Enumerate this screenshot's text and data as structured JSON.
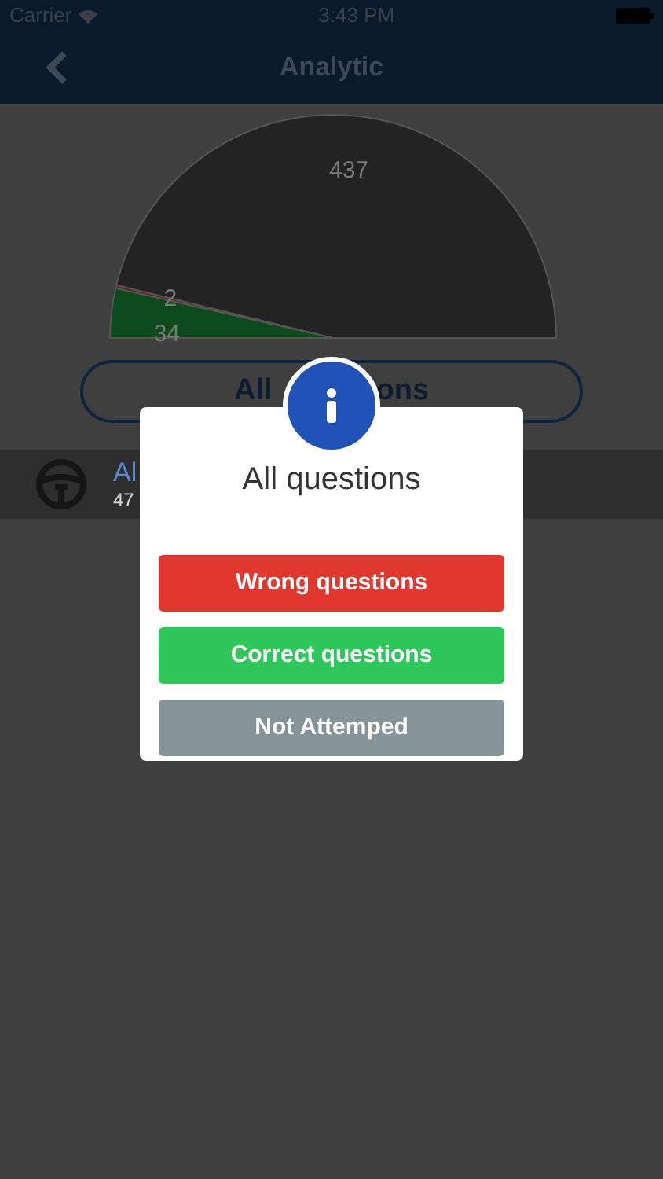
{
  "status_bar": {
    "carrier": "Carrier",
    "time": "3:43 PM"
  },
  "nav": {
    "title": "Analytic"
  },
  "chart": {
    "chart_data": {
      "type": "pie",
      "values": [
        34,
        2,
        437
      ],
      "data_labels": true
    }
  },
  "filter_button": {
    "label_parts": [
      "All",
      "ons"
    ]
  },
  "row": {
    "title": "Al",
    "subtitle": "47"
  },
  "dialog": {
    "title": "All questions",
    "buttons": [
      {
        "label": "Wrong questions",
        "kind": "wrong"
      },
      {
        "label": "Correct questions",
        "kind": "correct"
      },
      {
        "label": "Not Attemped",
        "kind": "skipped"
      }
    ]
  }
}
